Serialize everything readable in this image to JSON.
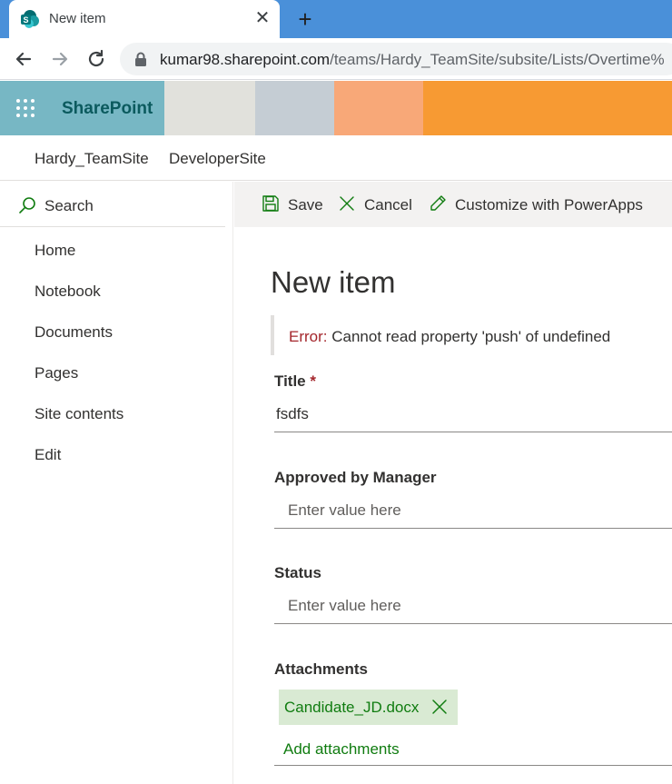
{
  "browser": {
    "tab_title": "New item",
    "new_tab_symbol": "+",
    "close_symbol": "✕",
    "url_host": "kumar98.sharepoint.com",
    "url_path": "/teams/Hardy_TeamSite/subsite/Lists/Overtime%"
  },
  "suite_bar": {
    "brand": "SharePoint",
    "colors": [
      "#77b7c4",
      "#e1e1dc",
      "#c5cdd4",
      "#f8a878",
      "#f79a33"
    ]
  },
  "site_nav": {
    "links": [
      "Hardy_TeamSite",
      "DeveloperSite"
    ]
  },
  "left_nav": {
    "search_label": "Search",
    "items": [
      "Home",
      "Notebook",
      "Documents",
      "Pages",
      "Site contents",
      "Edit"
    ]
  },
  "command_bar": {
    "save": "Save",
    "cancel": "Cancel",
    "customize": "Customize with PowerApps"
  },
  "form": {
    "title": "New item",
    "error_prefix": "Error:",
    "error_message": " Cannot read property 'push' of undefined",
    "fields": {
      "title": {
        "label": "Title",
        "required_mark": " *",
        "value": "fsdfs"
      },
      "approved_by_manager": {
        "label": "Approved by Manager",
        "placeholder": "Enter value here"
      },
      "status": {
        "label": "Status",
        "placeholder": "Enter value here"
      }
    },
    "attachments": {
      "label": "Attachments",
      "files": [
        "Candidate_JD.docx"
      ],
      "add_label": "Add attachments"
    }
  }
}
